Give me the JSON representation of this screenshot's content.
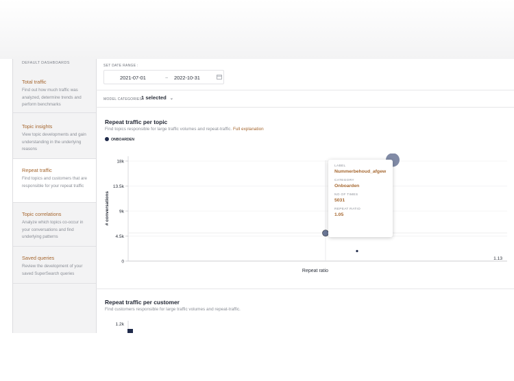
{
  "sidebar": {
    "heading": "DEFAULT DASHBOARDS",
    "items": [
      {
        "title": "Total traffic",
        "desc": "Find out how much traffic was analyzed, determine trends and perform benchmarks"
      },
      {
        "title": "Topic insights",
        "desc": "View topic developments and gain understanding in the underlying reasons"
      },
      {
        "title": "Repeat traffic",
        "desc": "Find topics and customers that are responsible for your repeat traffic"
      },
      {
        "title": "Topic correlations",
        "desc": "Analyze which topics co-occur in your conversations and find underlying patterns"
      },
      {
        "title": "Saved queries",
        "desc": "Review the development of your saved SuperSearch queries"
      }
    ]
  },
  "filters": {
    "date_range_label": "SET DATE RANGE :",
    "date_from": "2021-07-01",
    "date_separator": "~",
    "date_to": "2022-10-31",
    "model_categories_label": "MODEL CATEGORIES",
    "model_categories_value": "1 selected"
  },
  "section1": {
    "title": "Repeat traffic per topic",
    "subtitle": "Find topics responsible for large traffic volumes and repeat-traffic.",
    "link": "Full explanation",
    "legend": "ONBOARDEN"
  },
  "tooltip": {
    "label_key": "LABEL",
    "label_val": "Nummerbehoud_afgew",
    "category_key": "CATEGORY",
    "category_val": "Onboarden",
    "times_key": "NO OF TIMES",
    "times_val": "5031",
    "ratio_key": "REPEAT RATIO",
    "ratio_val": "1.05"
  },
  "section2": {
    "title": "Repeat traffic per customer",
    "subtitle": "Find customers responsible for large traffic volumes and repeat-traffic."
  },
  "colors": {
    "accent": "#a5662e",
    "series": "#1f2a4a",
    "bubble": "#6b7796"
  },
  "chart_data": [
    {
      "type": "scatter",
      "title": "",
      "xlabel": "Repeat ratio",
      "ylabel": "# conversations",
      "y_ticks": [
        "18k",
        "13.5k",
        "9k",
        "4.5k",
        "0"
      ],
      "x_ticks": [
        "1.13"
      ],
      "ylim": [
        0,
        18000
      ],
      "xlim": [
        0,
        1.13
      ],
      "series": [
        {
          "name": "ONBOARDEN",
          "points": [
            {
              "x": 1.05,
              "y": 5031
            },
            {
              "x": 1.13,
              "y": 18200
            },
            {
              "x": 1.09,
              "y": 1800
            }
          ]
        }
      ]
    },
    {
      "type": "bar",
      "title": "",
      "y_ticks": [
        "1.2k"
      ],
      "values": [
        1200
      ]
    }
  ]
}
